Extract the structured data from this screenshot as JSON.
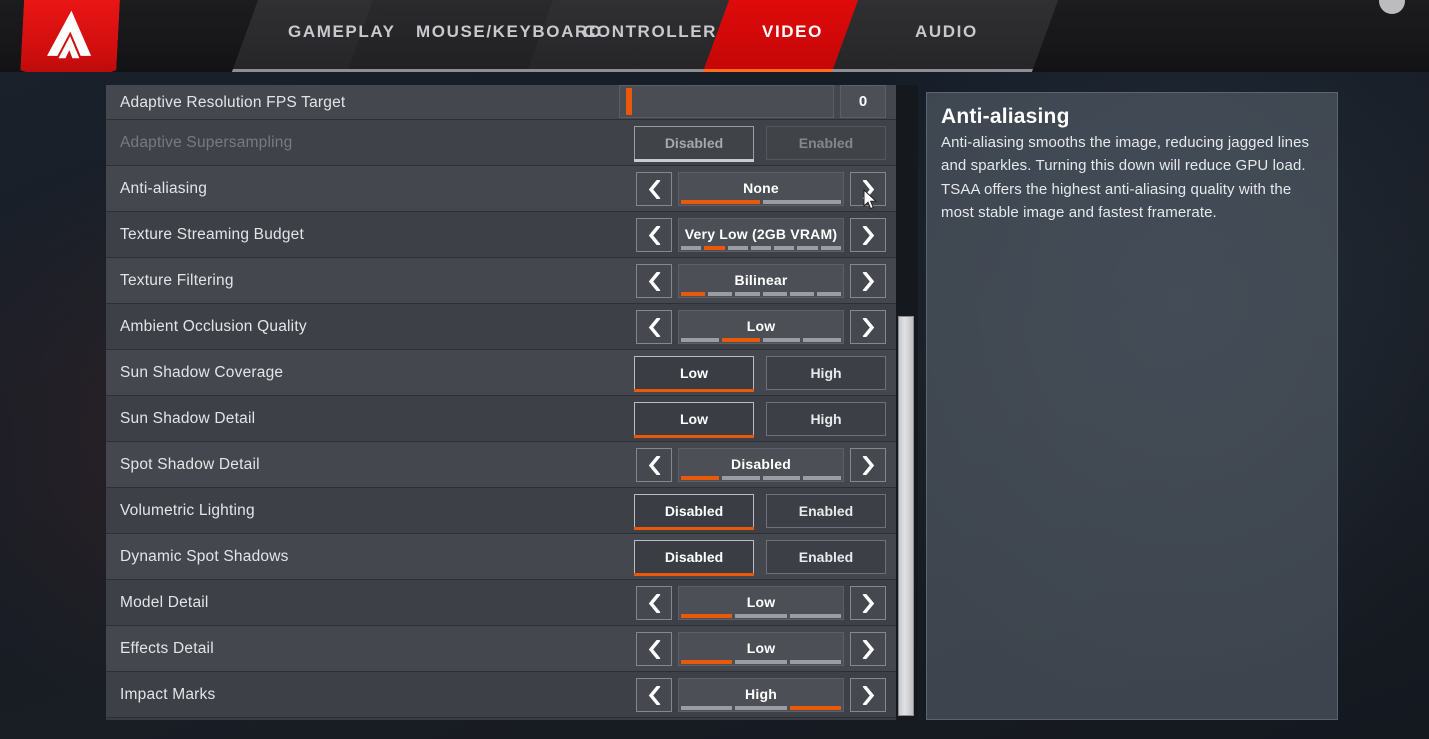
{
  "header": {
    "logo_alt": "apex-legends-logo",
    "tabs": [
      {
        "label": "GAMEPLAY",
        "active": false
      },
      {
        "label": "MOUSE/KEYBOARD",
        "active": false
      },
      {
        "label": "CONTROLLER",
        "active": false
      },
      {
        "label": "VIDEO",
        "active": true
      },
      {
        "label": "AUDIO",
        "active": false
      }
    ]
  },
  "colors": {
    "accent_orange": "#e8590c",
    "brand_red": "#e00a0a",
    "row_bg": "#44484e",
    "panel_bg": "#3a3e44",
    "text": "#e3e4e6"
  },
  "settings": [
    {
      "name": "Adaptive Resolution FPS Target",
      "type": "slider",
      "value": "0",
      "fill_percent": 3,
      "disabled": false,
      "partial": true
    },
    {
      "name": "Adaptive Supersampling",
      "type": "toggle",
      "options": [
        "Disabled",
        "Enabled"
      ],
      "selected_index": 0,
      "disabled": true
    },
    {
      "name": "Anti-aliasing",
      "type": "stepper",
      "value": "None",
      "segments": 2,
      "segment_index": 0,
      "disabled": false
    },
    {
      "name": "Texture Streaming Budget",
      "type": "stepper",
      "value": "Very Low (2GB VRAM)",
      "segments": 7,
      "segment_index": 1,
      "disabled": false
    },
    {
      "name": "Texture Filtering",
      "type": "stepper",
      "value": "Bilinear",
      "segments": 6,
      "segment_index": 0,
      "disabled": false
    },
    {
      "name": "Ambient Occlusion Quality",
      "type": "stepper",
      "value": "Low",
      "segments": 4,
      "segment_index": 1,
      "disabled": false
    },
    {
      "name": "Sun Shadow Coverage",
      "type": "toggle",
      "options": [
        "Low",
        "High"
      ],
      "selected_index": 0,
      "disabled": false
    },
    {
      "name": "Sun Shadow Detail",
      "type": "toggle",
      "options": [
        "Low",
        "High"
      ],
      "selected_index": 0,
      "disabled": false
    },
    {
      "name": "Spot Shadow Detail",
      "type": "stepper",
      "value": "Disabled",
      "segments": 4,
      "segment_index": 0,
      "disabled": false
    },
    {
      "name": "Volumetric Lighting",
      "type": "toggle",
      "options": [
        "Disabled",
        "Enabled"
      ],
      "selected_index": 0,
      "disabled": false
    },
    {
      "name": "Dynamic Spot Shadows",
      "type": "toggle",
      "options": [
        "Disabled",
        "Enabled"
      ],
      "selected_index": 0,
      "disabled": false
    },
    {
      "name": "Model Detail",
      "type": "stepper",
      "value": "Low",
      "segments": 3,
      "segment_index": 0,
      "disabled": false
    },
    {
      "name": "Effects Detail",
      "type": "stepper",
      "value": "Low",
      "segments": 3,
      "segment_index": 0,
      "disabled": false
    },
    {
      "name": "Impact Marks",
      "type": "stepper",
      "value": "High",
      "segments": 3,
      "segment_index": 2,
      "disabled": false
    }
  ],
  "description": {
    "title": "Anti-aliasing",
    "body": "Anti-aliasing smooths the image, reducing jagged lines and sparkles. Turning this down will reduce GPU load. TSAA offers the highest anti-aliasing quality with the most stable image and fastest framerate."
  },
  "scrollbar": {
    "orientation": "vertical",
    "thumb_top_percent": 36,
    "thumb_height_percent": 63
  }
}
